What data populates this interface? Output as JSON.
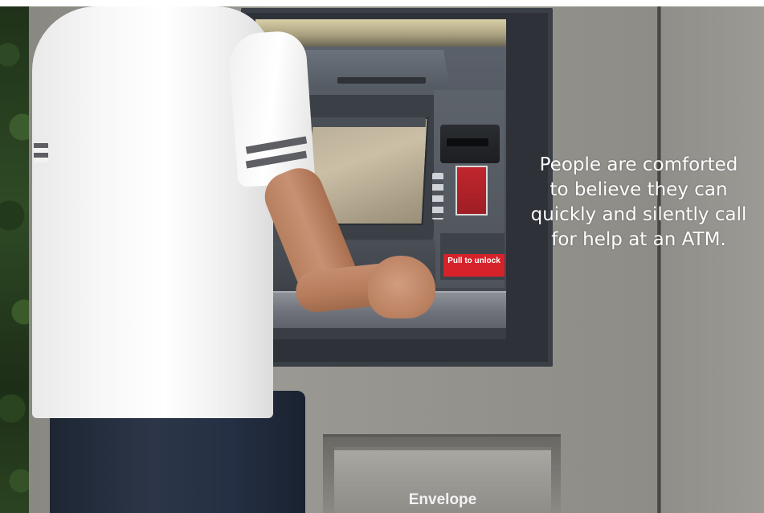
{
  "caption": {
    "text": "People are comforted to believe they can quickly and silently call for help at an ATM."
  },
  "atm": {
    "receipt_label": "Pull to unlock",
    "envelope_label": "Envelope"
  },
  "colors": {
    "caption_text": "#ffffff",
    "kiosk": "#94928c",
    "atm_face": "#4c5158",
    "warning_label": "#d6222a",
    "shirt": "#f6f6f6",
    "pants": "#253044"
  },
  "icons": [
    "card-reader-icon",
    "accessibility-icons"
  ]
}
